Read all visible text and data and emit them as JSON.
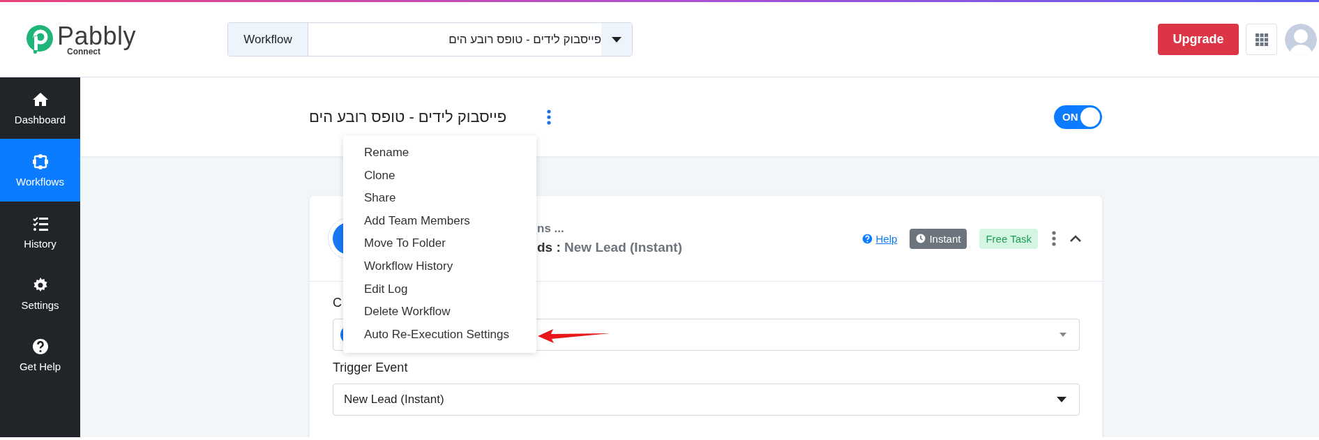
{
  "top_bar": {
    "brand": "Pabbly",
    "brand_sub": "Connect",
    "workflow_select": {
      "label": "Workflow",
      "value": "פייסבוק לידים - טופס רובע הים"
    },
    "upgrade_button": "Upgrade"
  },
  "sidebar": {
    "items": [
      {
        "label": "Dashboard",
        "selected": false
      },
      {
        "label": "Workflows",
        "selected": true
      },
      {
        "label": "History",
        "selected": false
      },
      {
        "label": "Settings",
        "selected": false
      },
      {
        "label": "Get Help",
        "selected": false
      }
    ]
  },
  "workflow_header": {
    "title": "פייסבוק לידים - טופס רובע הים",
    "active": true,
    "toggle_label": "ON"
  },
  "context_menu": {
    "items": [
      "Rename",
      "Clone",
      "Share",
      "Add Team Members",
      "Move To Folder",
      "Workflow History",
      "Edit Log",
      "Delete Workflow",
      "Auto Re-Execution Settings"
    ]
  },
  "trigger_card": {
    "app_line": "ns ...",
    "event_prefix": "ds :",
    "event_name": "New Lead (Instant)",
    "help_link": "Help",
    "expanded": true,
    "badges": [
      {
        "label": "Instant",
        "kind": "type"
      },
      {
        "label": "Free Task",
        "kind": "cost"
      }
    ],
    "fields": [
      {
        "label": "C",
        "kind": "app"
      },
      {
        "label": "Trigger Event",
        "kind": "select",
        "value": "New Lead (Instant)"
      }
    ]
  }
}
